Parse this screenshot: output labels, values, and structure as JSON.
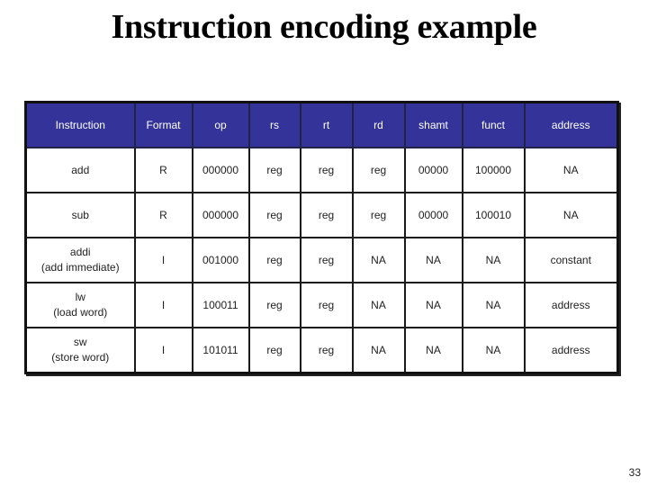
{
  "slide": {
    "title": "Instruction encoding example",
    "page_number": "33"
  },
  "table": {
    "header_color": "#333399",
    "columns": [
      "Instruction",
      "Format",
      "op",
      "rs",
      "rt",
      "rd",
      "shamt",
      "funct",
      "address"
    ],
    "rows": [
      {
        "instruction": "add",
        "instruction_note": "",
        "format": "R",
        "op": "000000",
        "rs": "reg",
        "rt": "reg",
        "rd": "reg",
        "shamt": "00000",
        "funct": "100000",
        "address": "NA"
      },
      {
        "instruction": "sub",
        "instruction_note": "",
        "format": "R",
        "op": "000000",
        "rs": "reg",
        "rt": "reg",
        "rd": "reg",
        "shamt": "00000",
        "funct": "100010",
        "address": "NA"
      },
      {
        "instruction": "addi",
        "instruction_note": "(add immediate)",
        "format": "I",
        "op": "001000",
        "rs": "reg",
        "rt": "reg",
        "rd": "NA",
        "shamt": "NA",
        "funct": "NA",
        "address": "constant"
      },
      {
        "instruction": "lw",
        "instruction_note": "(load word)",
        "format": "I",
        "op": "100011",
        "rs": "reg",
        "rt": "reg",
        "rd": "NA",
        "shamt": "NA",
        "funct": "NA",
        "address": "address"
      },
      {
        "instruction": "sw",
        "instruction_note": "(store word)",
        "format": "I",
        "op": "101011",
        "rs": "reg",
        "rt": "reg",
        "rd": "NA",
        "shamt": "NA",
        "funct": "NA",
        "address": "address"
      }
    ]
  }
}
